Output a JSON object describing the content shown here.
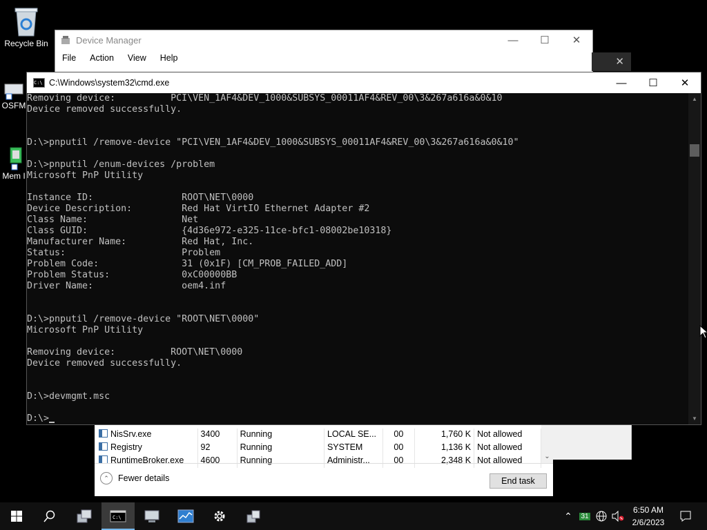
{
  "desktop": {
    "icons": [
      {
        "label": "Recycle Bin",
        "icon": "recycle-bin-icon"
      },
      {
        "label": "OSFM",
        "icon": "shortcut-icon"
      },
      {
        "label": "Mem I",
        "icon": "shortcut-icon"
      }
    ]
  },
  "device_manager": {
    "title": "Device Manager",
    "menu": [
      "File",
      "Action",
      "View",
      "Help"
    ]
  },
  "cmd": {
    "title": "C:\\Windows\\system32\\cmd.exe",
    "lines": [
      "Removing device:          PCI\\VEN_1AF4&DEV_1000&SUBSYS_00011AF4&REV_00\\3&267a616a&0&10",
      "Device removed successfully.",
      "",
      "",
      "D:\\>pnputil /remove-device \"PCI\\VEN_1AF4&DEV_1000&SUBSYS_00011AF4&REV_00\\3&267a616a&0&10\"",
      "",
      "D:\\>pnputil /enum-devices /problem",
      "Microsoft PnP Utility",
      "",
      "Instance ID:                ROOT\\NET\\0000",
      "Device Description:         Red Hat VirtIO Ethernet Adapter #2",
      "Class Name:                 Net",
      "Class GUID:                 {4d36e972-e325-11ce-bfc1-08002be10318}",
      "Manufacturer Name:          Red Hat, Inc.",
      "Status:                     Problem",
      "Problem Code:               31 (0x1F) [CM_PROB_FAILED_ADD]",
      "Problem Status:             0xC00000BB",
      "Driver Name:                oem4.inf",
      "",
      "",
      "D:\\>pnputil /remove-device \"ROOT\\NET\\0000\"",
      "Microsoft PnP Utility",
      "",
      "Removing device:          ROOT\\NET\\0000",
      "Device removed successfully.",
      "",
      "",
      "D:\\>devmgmt.msc",
      ""
    ],
    "prompt": "D:\\>"
  },
  "task_manager": {
    "rows": [
      {
        "name": "NisSrv.exe",
        "pid": "3400",
        "status": "Running",
        "user": "LOCAL SE...",
        "cpu": "00",
        "memory": "1,760 K",
        "uac": "Not allowed"
      },
      {
        "name": "Registry",
        "pid": "92",
        "status": "Running",
        "user": "SYSTEM",
        "cpu": "00",
        "memory": "1,136 K",
        "uac": "Not allowed"
      },
      {
        "name": "RuntimeBroker.exe",
        "pid": "4600",
        "status": "Running",
        "user": "Administr...",
        "cpu": "00",
        "memory": "2,348 K",
        "uac": "Not allowed"
      }
    ],
    "fewer_details": "Fewer details",
    "end_task": "End task"
  },
  "taskbar": {
    "apps": [
      "server-manager-icon",
      "cmd-icon",
      "device-manager-icon",
      "task-manager-icon",
      "settings-gear-icon",
      "network-setup-icon"
    ],
    "tray_badge": "31",
    "time": "6:50 AM",
    "date": "2/6/2023"
  }
}
